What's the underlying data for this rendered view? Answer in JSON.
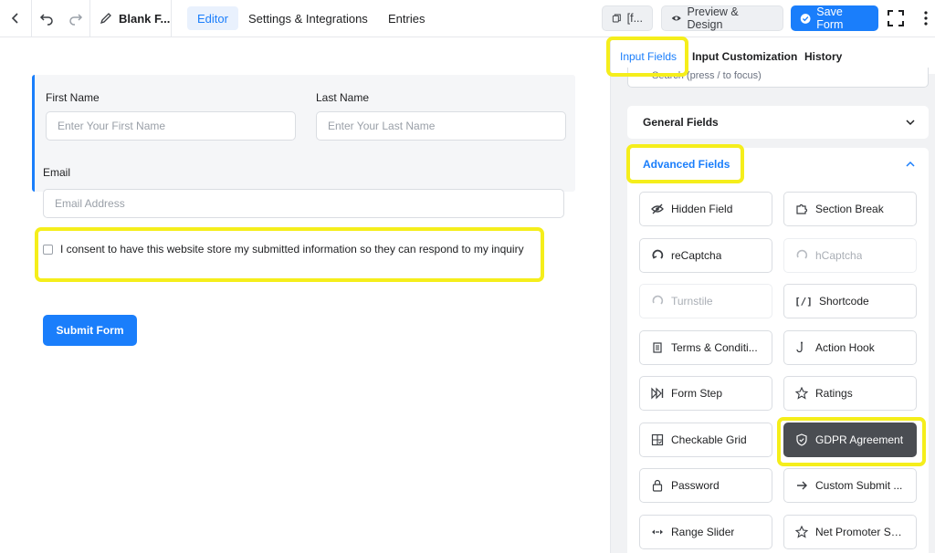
{
  "topbar": {
    "form_name": "Blank F...",
    "tabs": [
      {
        "label": "Editor",
        "active": true
      },
      {
        "label": "Settings & Integrations",
        "active": false
      },
      {
        "label": "Entries",
        "active": false
      }
    ],
    "shortcode_label": "[f...",
    "preview_label": "Preview & Design",
    "save_label": "Save Form"
  },
  "editor": {
    "first_name": {
      "label": "First Name",
      "placeholder": "Enter Your First Name"
    },
    "last_name": {
      "label": "Last Name",
      "placeholder": "Enter Your Last Name"
    },
    "email": {
      "label": "Email",
      "placeholder": "Email Address"
    },
    "consent_text": "I consent to have this website store my submitted information so they can respond to my inquiry",
    "submit_label": "Submit Form"
  },
  "panel": {
    "tabs": [
      {
        "label": "Input Fields",
        "active": true
      },
      {
        "label": "Input Customization",
        "active": false
      },
      {
        "label": "History",
        "active": false
      }
    ],
    "search_placeholder": "Search (press  /  to focus)",
    "general_fields_label": "General Fields",
    "advanced_fields_label": "Advanced Fields",
    "fields": [
      {
        "label": "Hidden Field",
        "icon": "eye-slash-icon",
        "state": "normal"
      },
      {
        "label": "Section Break",
        "icon": "puzzle-icon",
        "state": "normal"
      },
      {
        "label": "reCaptcha",
        "icon": "recaptcha-icon",
        "state": "normal"
      },
      {
        "label": "hCaptcha",
        "icon": "hcaptcha-icon",
        "state": "disabled"
      },
      {
        "label": "Turnstile",
        "icon": "turnstile-icon",
        "state": "disabled"
      },
      {
        "label": "Shortcode",
        "icon": "shortcode-icon",
        "state": "normal"
      },
      {
        "label": "Terms & Conditi...",
        "icon": "scroll-icon",
        "state": "normal"
      },
      {
        "label": "Action Hook",
        "icon": "hook-icon",
        "state": "normal"
      },
      {
        "label": "Form Step",
        "icon": "step-forward-icon",
        "state": "normal"
      },
      {
        "label": "Ratings",
        "icon": "star-icon",
        "state": "normal"
      },
      {
        "label": "Checkable Grid",
        "icon": "grid-check-icon",
        "state": "normal"
      },
      {
        "label": "GDPR Agreement",
        "icon": "shield-icon",
        "state": "selected"
      },
      {
        "label": "Password",
        "icon": "lock-icon",
        "state": "normal"
      },
      {
        "label": "Custom Submit ...",
        "icon": "arrow-right-icon",
        "state": "normal"
      },
      {
        "label": "Range Slider",
        "icon": "range-icon",
        "state": "normal"
      },
      {
        "label": "Net Promoter Sc...",
        "icon": "star-outline-icon",
        "state": "normal"
      }
    ]
  },
  "colors": {
    "accent": "#1a7efb",
    "highlight": "#f5ee1b",
    "selected_field": "#4a4d52"
  }
}
